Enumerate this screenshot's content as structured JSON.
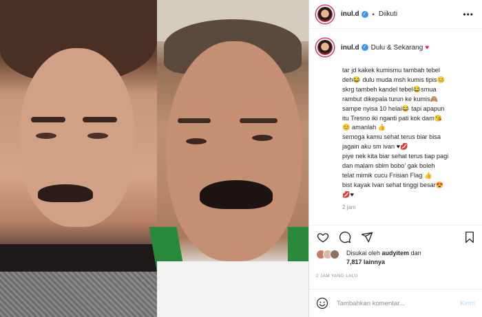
{
  "post": {
    "author": "inul.d",
    "follow_state": "Diikuti",
    "separator": "•",
    "more": "•••",
    "caption_title": "Dulu & Sekarang",
    "caption_heart": "♥",
    "caption_lines": [
      "tar jd kakek kumismu tambah tebel",
      "deh😂 dulu muda msh kumis tipis😊",
      "skrg tambeh kandel tebel😂smua",
      "rambut dikepala turun ke kumis🙈",
      "sampe nyisa 10 helai😂 tapi apapun",
      "itu Tresno iki nganti pati kok dam😘",
      "😊 amanlah 👍",
      "semoga kamu sehat terus biar bisa",
      "jagain aku sm ivan ♥💋",
      "piye nek kita biar sehat terus tiap pagi",
      "dan malam sblm bobo' gak boleh",
      "telat mimik cucu Frisian Flag 👍",
      "bist kayak Ivan sehat tinggi besar😍",
      "💋♥"
    ],
    "time_ago": "2 jam",
    "likes_prefix": "Disukai oleh",
    "liked_by": "audyitem",
    "likes_and": "dan",
    "likes_count": "7,817 lainnya",
    "posted_label": "2 JAM YANG LALU"
  },
  "comment": {
    "placeholder": "Tambahkan komentar...",
    "post_label": "Kirim"
  },
  "icons": {
    "like": "heart-outline-icon",
    "comment": "comment-icon",
    "share": "share-icon",
    "save": "bookmark-icon",
    "emoji": "emoji-icon"
  },
  "colors": {
    "verified": "#3897f0",
    "heart": "#e0245e",
    "post_button": "#b3dbff"
  }
}
